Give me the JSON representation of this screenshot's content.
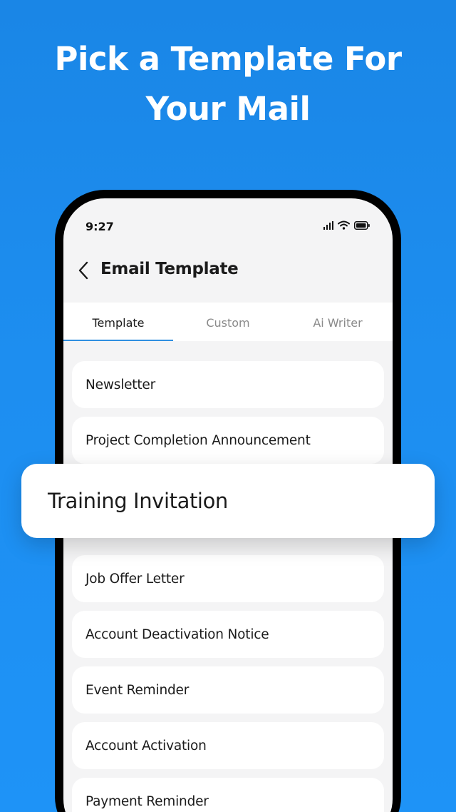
{
  "headline": {
    "line1": "Pick a Template For",
    "line2": "Your Mail"
  },
  "status_bar": {
    "time": "9:27",
    "icons": [
      "signal-icon",
      "wifi-icon",
      "battery-icon"
    ]
  },
  "header": {
    "back_icon": "chevron-left-icon",
    "title": "Email Template"
  },
  "tabs": [
    {
      "label": "Template",
      "active": true
    },
    {
      "label": "Custom",
      "active": false
    },
    {
      "label": "Ai Writer",
      "active": false
    }
  ],
  "templates_before": [
    {
      "label": "Newsletter"
    },
    {
      "label": "Project Completion Announcement"
    }
  ],
  "highlighted_template": "Training Invitation",
  "templates_after": [
    {
      "label": "Job Offer Letter"
    },
    {
      "label": "Account Deactivation Notice"
    },
    {
      "label": "Event Reminder"
    },
    {
      "label": "Account Activation"
    },
    {
      "label": "Payment Reminder"
    }
  ],
  "colors": {
    "background": "#1e8ff2",
    "accent": "#2f8fe0",
    "card": "#ffffff"
  }
}
